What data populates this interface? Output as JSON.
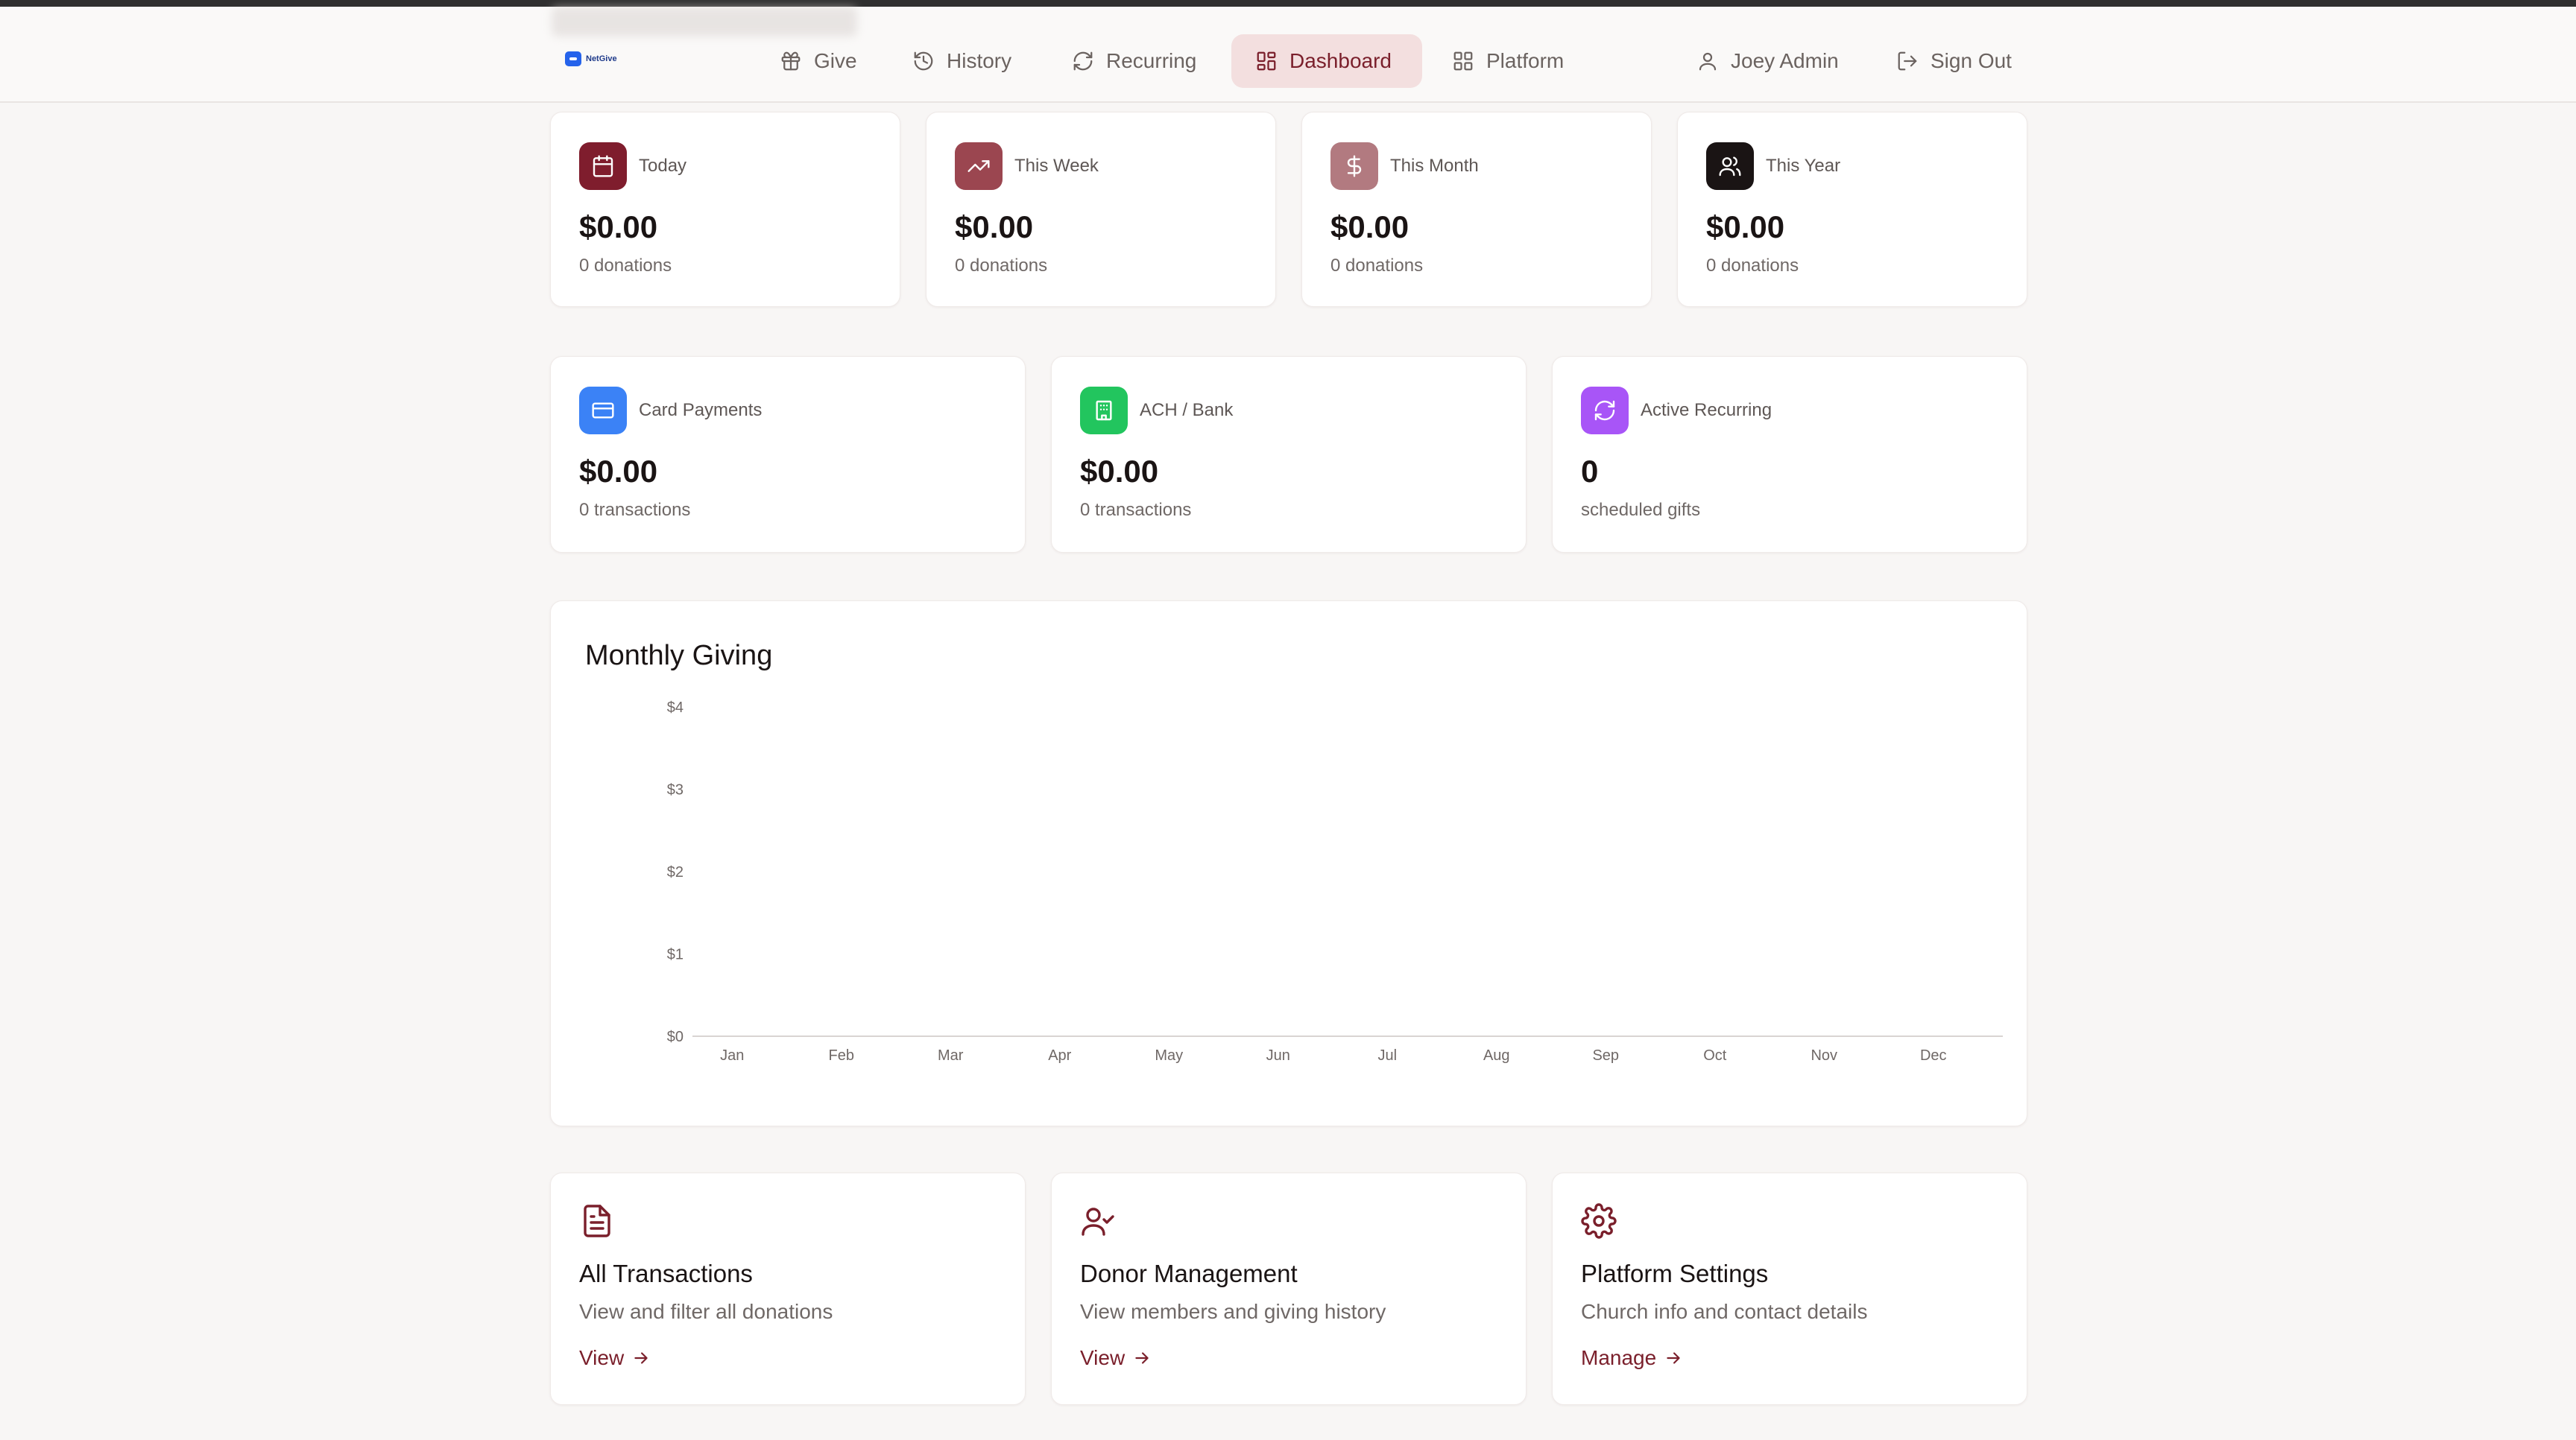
{
  "nav": {
    "items": [
      {
        "label": "Give",
        "icon": "gift-icon"
      },
      {
        "label": "History",
        "icon": "history-icon"
      },
      {
        "label": "Recurring",
        "icon": "refresh-icon"
      },
      {
        "label": "Dashboard",
        "icon": "grid-icon",
        "active": true
      },
      {
        "label": "Platform",
        "icon": "grid-icon"
      }
    ],
    "user": "Joey Admin",
    "signout": "Sign Out",
    "logo_text": "NetGive"
  },
  "stats_period": [
    {
      "label": "Today",
      "value": "$0.00",
      "sub": "0 donations",
      "icon": "calendar-icon",
      "color": "#7f1d2d"
    },
    {
      "label": "This Week",
      "value": "$0.00",
      "sub": "0 donations",
      "icon": "trending-up-icon",
      "color": "#9b4650"
    },
    {
      "label": "This Month",
      "value": "$0.00",
      "sub": "0 donations",
      "icon": "dollar-icon",
      "color": "#b27a80"
    },
    {
      "label": "This Year",
      "value": "$0.00",
      "sub": "0 donations",
      "icon": "users-icon",
      "color": "#1a1414"
    }
  ],
  "stats_method": [
    {
      "label": "Card Payments",
      "value": "$0.00",
      "sub": "0 transactions",
      "icon": "credit-card-icon",
      "color": "#3b82f6"
    },
    {
      "label": "ACH / Bank",
      "value": "$0.00",
      "sub": "0 transactions",
      "icon": "bank-icon",
      "color": "#22c55e"
    },
    {
      "label": "Active Recurring",
      "value": "0",
      "sub": "scheduled gifts",
      "icon": "refresh-icon",
      "color": "#a855f7"
    }
  ],
  "chart": {
    "title": "Monthly Giving"
  },
  "chart_data": {
    "type": "bar",
    "categories": [
      "Jan",
      "Feb",
      "Mar",
      "Apr",
      "May",
      "Jun",
      "Jul",
      "Aug",
      "Sep",
      "Oct",
      "Nov",
      "Dec"
    ],
    "values": [
      0,
      0,
      0,
      0,
      0,
      0,
      0,
      0,
      0,
      0,
      0,
      0
    ],
    "yticks": [
      "$0",
      "$1",
      "$2",
      "$3",
      "$4"
    ],
    "ylim": [
      0,
      4
    ],
    "title": "Monthly Giving",
    "xlabel": "",
    "ylabel": "",
    "grid": false
  },
  "actions": [
    {
      "title": "All Transactions",
      "desc": "View and filter all donations",
      "link": "View",
      "icon": "file-text-icon"
    },
    {
      "title": "Donor Management",
      "desc": "View members and giving history",
      "link": "View",
      "icon": "user-check-icon"
    },
    {
      "title": "Platform Settings",
      "desc": "Church info and contact details",
      "link": "Manage",
      "icon": "settings-icon"
    }
  ],
  "colors": {
    "accent": "#7a1f2b",
    "active_nav_bg": "#f3dfdf",
    "page_bg": "#f8f6f5"
  }
}
